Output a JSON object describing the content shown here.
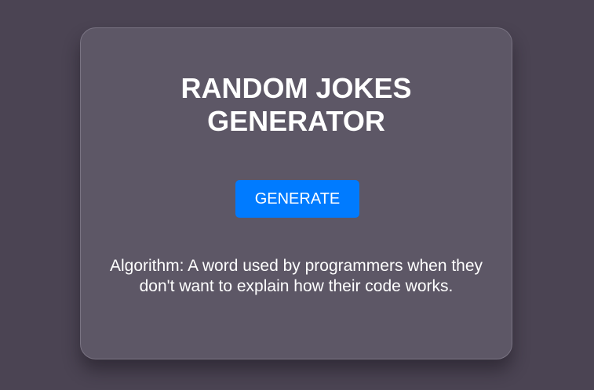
{
  "card": {
    "title": "RANDOM JOKES GENERATOR",
    "button_label": "GENERATE",
    "joke_text": "Algorithm: A word used by programmers when they don't want to explain how their code works."
  },
  "colors": {
    "background": "#4b4453",
    "card": "#5d5766",
    "button": "#007bff",
    "text": "#ffffff"
  }
}
